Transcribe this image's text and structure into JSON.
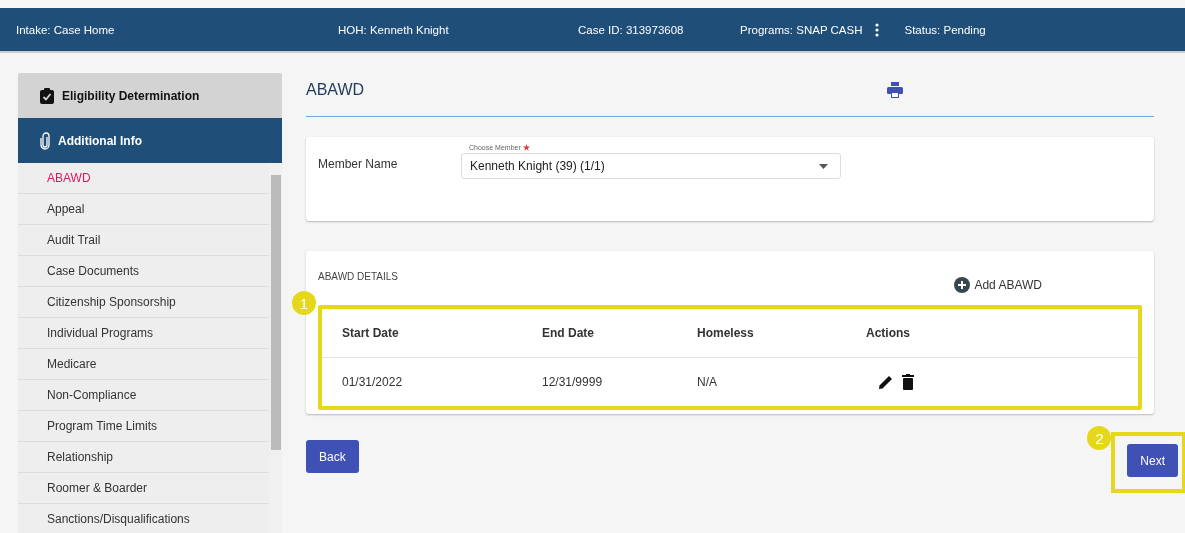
{
  "header": {
    "items": [
      {
        "label": "Intake: Case Home"
      },
      {
        "label": "HOH: Kenneth Knight"
      },
      {
        "label": "Case ID: 313973608"
      },
      {
        "label": "Programs: SNAP CASH",
        "menu": true
      },
      {
        "label": "Status: Pending"
      }
    ]
  },
  "sidebar": {
    "sections": [
      {
        "label": "Eligibility Determination",
        "kind": "clipboard",
        "selected": false
      },
      {
        "label": "Additional Info",
        "kind": "paperclip",
        "selected": true
      }
    ],
    "items": [
      {
        "label": "ABAWD",
        "selected": true
      },
      {
        "label": "Appeal",
        "selected": false
      },
      {
        "label": "Audit Trail",
        "selected": false
      },
      {
        "label": "Case Documents",
        "selected": false
      },
      {
        "label": "Citizenship Sponsorship",
        "selected": false
      },
      {
        "label": "Individual Programs",
        "selected": false
      },
      {
        "label": "Medicare",
        "selected": false
      },
      {
        "label": "Non-Compliance",
        "selected": false
      },
      {
        "label": "Program Time Limits",
        "selected": false
      },
      {
        "label": "Relationship",
        "selected": false
      },
      {
        "label": "Roomer & Boarder",
        "selected": false
      },
      {
        "label": "Sanctions/Disqualifications",
        "selected": false
      }
    ]
  },
  "page": {
    "title": "ABAWD"
  },
  "member": {
    "label": "Member Name",
    "field_label": "Choose Member",
    "required": true,
    "value": "Kenneth Knight (39) (1/1)"
  },
  "details": {
    "title": "ABAWD DETAILS",
    "add_button": "Add ABAWD",
    "callout": "1",
    "columns": [
      "Start Date",
      "End Date",
      "Homeless",
      "Actions"
    ],
    "rows": [
      {
        "cells": [
          "01/31/2022",
          "12/31/9999",
          "N/A"
        ]
      }
    ]
  },
  "footer": {
    "back": "Back",
    "next": "Next",
    "next_callout": "2"
  }
}
